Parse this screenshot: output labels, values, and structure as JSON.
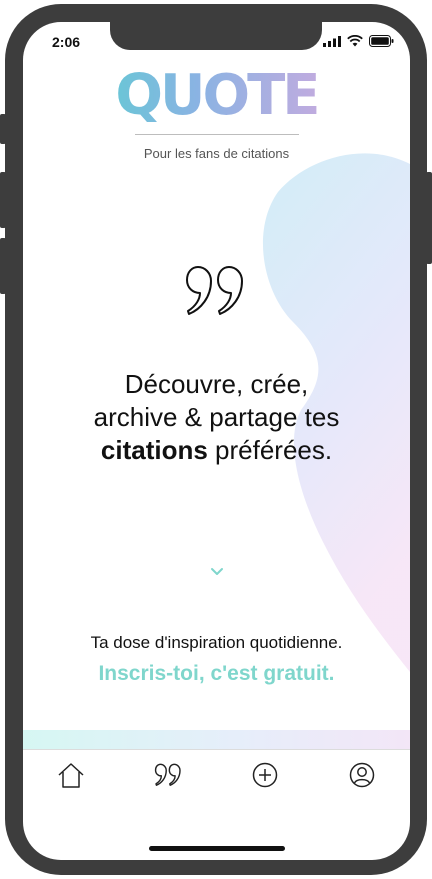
{
  "status_bar": {
    "time": "2:06"
  },
  "brand": {
    "logo_text": "QUOTE",
    "tagline": "Pour les fans de citations"
  },
  "hero": {
    "line1": "Découvre, crée,",
    "line2": "archive & partage tes",
    "line3_bold": "citations",
    "line3_rest": " préférées."
  },
  "cta": {
    "subtitle": "Ta dose d'inspiration quotidienne.",
    "signup": "Inscris-toi, c'est gratuit."
  },
  "tab_bar": {
    "items": [
      {
        "icon": "home-icon"
      },
      {
        "icon": "quote-icon"
      },
      {
        "icon": "add-icon"
      },
      {
        "icon": "profile-icon"
      }
    ]
  },
  "colors": {
    "accent_teal": "#7fd6cc",
    "logo_gradient": [
      "#48d9c9",
      "#8ab3e3",
      "#e9a6dc"
    ],
    "frame": "#3d3d3d"
  }
}
